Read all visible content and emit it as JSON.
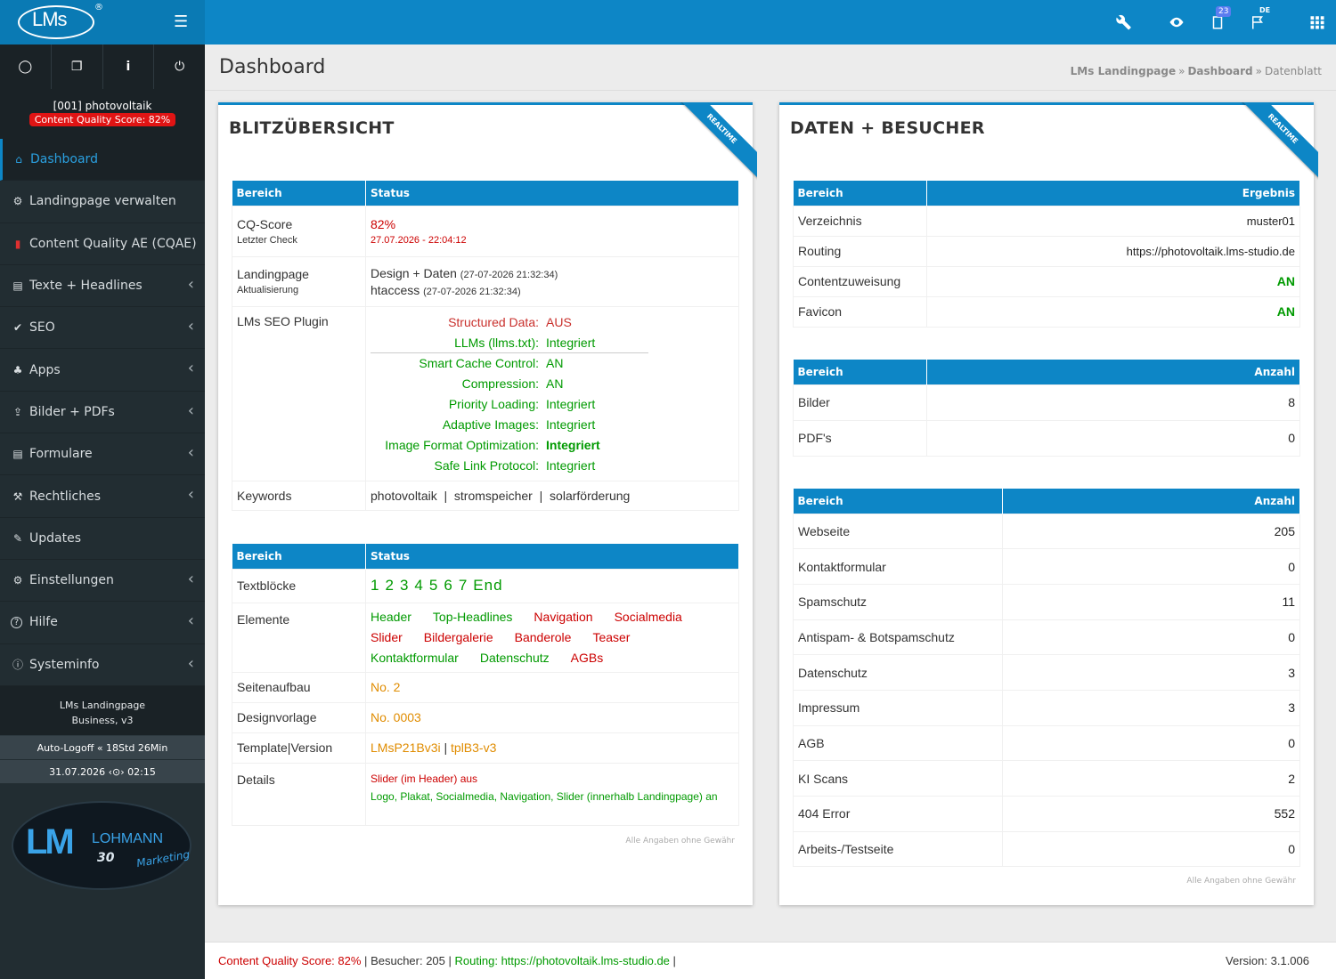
{
  "topbar": {
    "logo_text": "LMs",
    "logo_mark": "®",
    "notifications_count": "23",
    "language": "DE",
    "icons": [
      "wrench-icon",
      "eye-icon",
      "clipboard-icon",
      "flag-icon",
      "grid-icon"
    ]
  },
  "sidebar": {
    "tools": [
      "refresh-icon",
      "copy-icon",
      "info-icon",
      "power-icon"
    ],
    "project": "[001] photovoltaik",
    "score_badge": "Content Quality Score: 82%",
    "items": [
      {
        "label": "Dashboard",
        "icon": "home-icon",
        "active": true,
        "chevron": false
      },
      {
        "label": "Landingpage verwalten",
        "icon": "gear-icon",
        "chevron": false
      },
      {
        "label": "Content Quality AE (CQAE)",
        "icon": "bar-chart-icon",
        "chevron": false
      },
      {
        "label": "Texte + Headlines",
        "icon": "document-icon",
        "chevron": true
      },
      {
        "label": "SEO",
        "icon": "check-icon",
        "chevron": true
      },
      {
        "label": "Apps",
        "icon": "sitemap-icon",
        "chevron": true
      },
      {
        "label": "Bilder + PDFs",
        "icon": "upload-icon",
        "chevron": true
      },
      {
        "label": "Formulare",
        "icon": "form-icon",
        "chevron": true
      },
      {
        "label": "Rechtliches",
        "icon": "gavel-icon",
        "chevron": true
      },
      {
        "label": "Updates",
        "icon": "wrench-icon",
        "chevron": false
      },
      {
        "label": "Einstellungen",
        "icon": "gears-icon",
        "chevron": true
      },
      {
        "label": "Hilfe",
        "icon": "question-icon",
        "chevron": true
      },
      {
        "label": "Systeminfo",
        "icon": "info-circle-icon",
        "chevron": true
      }
    ],
    "version_line1": "LMs Landingpage",
    "version_line2": "Business, v3",
    "autologoff": "Auto-Logoff « 18Std 26Min",
    "datetime": "31.07.2026 ‹⊙› 02:15",
    "brand": {
      "lm": "LM",
      "name": "LOHMANN",
      "years": "30",
      "tag": "Marketing"
    }
  },
  "header": {
    "title": "Dashboard",
    "breadcrumb": [
      "LMs Landingpage",
      "Dashboard",
      "Datenblatt"
    ]
  },
  "blitz": {
    "title": "BLITZÜBERSICHT",
    "ribbon": "REALTIME",
    "col1": "Bereich",
    "col2": "Status",
    "cq_label": "CQ-Score",
    "cq_sub": "Letzter Check",
    "cq_value": "82%",
    "cq_date": "27.07.2026 - 22:04:12",
    "lp_label": "Landingpage",
    "lp_sub": "Aktualisierung",
    "lp_design": "Design + Daten",
    "lp_design_date": "(27-07-2026 21:32:34)",
    "lp_ht": "htaccess",
    "lp_ht_date": "(27-07-2026 21:32:34)",
    "seo_label": "LMs SEO Plugin",
    "plugin": [
      {
        "key": "Structured Data:",
        "val": "AUS",
        "color": "red"
      },
      {
        "key": "LLMs (llms.txt):",
        "val": "Integriert",
        "color": "green"
      },
      {
        "key": "Smart Cache Control:",
        "val": "AN",
        "color": "green"
      },
      {
        "key": "Compression:",
        "val": "AN",
        "color": "green"
      },
      {
        "key": "Priority Loading:",
        "val": "Integriert",
        "color": "green"
      },
      {
        "key": "Adaptive Images:",
        "val": "Integriert",
        "color": "green"
      },
      {
        "key": "Image Format Optimization:",
        "val": "Integriert",
        "color": "green",
        "bold": true
      },
      {
        "key": "Safe Link Protocol:",
        "val": "Integriert",
        "color": "green"
      }
    ],
    "kw_label": "Keywords",
    "keywords": [
      "photovoltaik",
      "stromspeicher",
      "solarförderung"
    ],
    "col1b": "Bereich",
    "col2b": "Status",
    "tb_label": "Textblöcke",
    "textblocks": [
      "1",
      "2",
      "3",
      "4",
      "5",
      "6",
      "7",
      "End"
    ],
    "el_label": "Elemente",
    "elements": [
      [
        {
          "t": "Header",
          "c": "green"
        },
        {
          "t": "Top-Headlines",
          "c": "green"
        },
        {
          "t": "Navigation",
          "c": "red"
        },
        {
          "t": "Socialmedia",
          "c": "red"
        }
      ],
      [
        {
          "t": "Slider",
          "c": "red"
        },
        {
          "t": "Bildergalerie",
          "c": "red"
        },
        {
          "t": "Banderole",
          "c": "red"
        },
        {
          "t": "Teaser",
          "c": "red"
        }
      ],
      [
        {
          "t": "Kontaktformular",
          "c": "green"
        },
        {
          "t": "Datenschutz",
          "c": "green"
        },
        {
          "t": "AGBs",
          "c": "red"
        }
      ]
    ],
    "sa_label": "Seitenaufbau",
    "sa_value": "No. 2",
    "dv_label": "Designvorlage",
    "dv_value": "No. 0003",
    "tv_label": "Template|Version",
    "tv_value1": "LMsP21Bv3i",
    "tv_sep": "|",
    "tv_value2": "tplB3-v3",
    "det_label": "Details",
    "det_red": "Slider (im Header) aus",
    "det_green": "Logo, Plakat, Socialmedia, Navigation, Slider (innerhalb Landingpage) an",
    "note": "Alle Angaben ohne Gewähr"
  },
  "daten": {
    "title": "DATEN + BESUCHER",
    "ribbon": "REALTIME",
    "t1_col1": "Bereich",
    "t1_col2": "Ergebnis",
    "t1_rows": [
      {
        "label": "Verzeichnis",
        "value": "muster01",
        "color": "dark"
      },
      {
        "label": "Routing",
        "value": "https://photovoltaik.lms-studio.de",
        "color": "dark"
      },
      {
        "label": "Contentzuweisung",
        "value": "AN",
        "color": "green"
      },
      {
        "label": "Favicon",
        "value": "AN",
        "color": "green"
      }
    ],
    "t2_col1": "Bereich",
    "t2_col2": "Anzahl",
    "t2_rows": [
      {
        "label": "Bilder",
        "value": "8"
      },
      {
        "label": "PDF's",
        "value": "0"
      }
    ],
    "t3_col1": "Bereich",
    "t3_col2": "Anzahl",
    "t3_rows": [
      {
        "label": "Webseite",
        "value": "205"
      },
      {
        "label": "Kontaktformular",
        "value": "0"
      },
      {
        "label": "Spamschutz",
        "value": "11"
      },
      {
        "label": "Antispam- & Botspamschutz",
        "value": "0"
      },
      {
        "label": "Datenschutz",
        "value": "3"
      },
      {
        "label": "Impressum",
        "value": "3"
      },
      {
        "label": "AGB",
        "value": "0"
      },
      {
        "label": "KI Scans",
        "value": "2"
      },
      {
        "label": "404 Error",
        "value": "552"
      },
      {
        "label": "Arbeits-/Testseite",
        "value": "0"
      }
    ],
    "note": "Alle Angaben ohne Gewähr"
  },
  "footer": {
    "score": "Content Quality Score: 82%",
    "sep1": "|",
    "visitors": "Besucher: 205",
    "sep2": "|",
    "routing": "Routing: https://photovoltaik.lms-studio.de",
    "sep3": "|",
    "version": "Version: 3.1.006"
  },
  "colors": {
    "primary": "#0d86c6",
    "sidebar": "#222d32",
    "red": "#c9302c",
    "green": "#009a00",
    "orange": "#e08c00",
    "badge_red": "#e01414"
  }
}
